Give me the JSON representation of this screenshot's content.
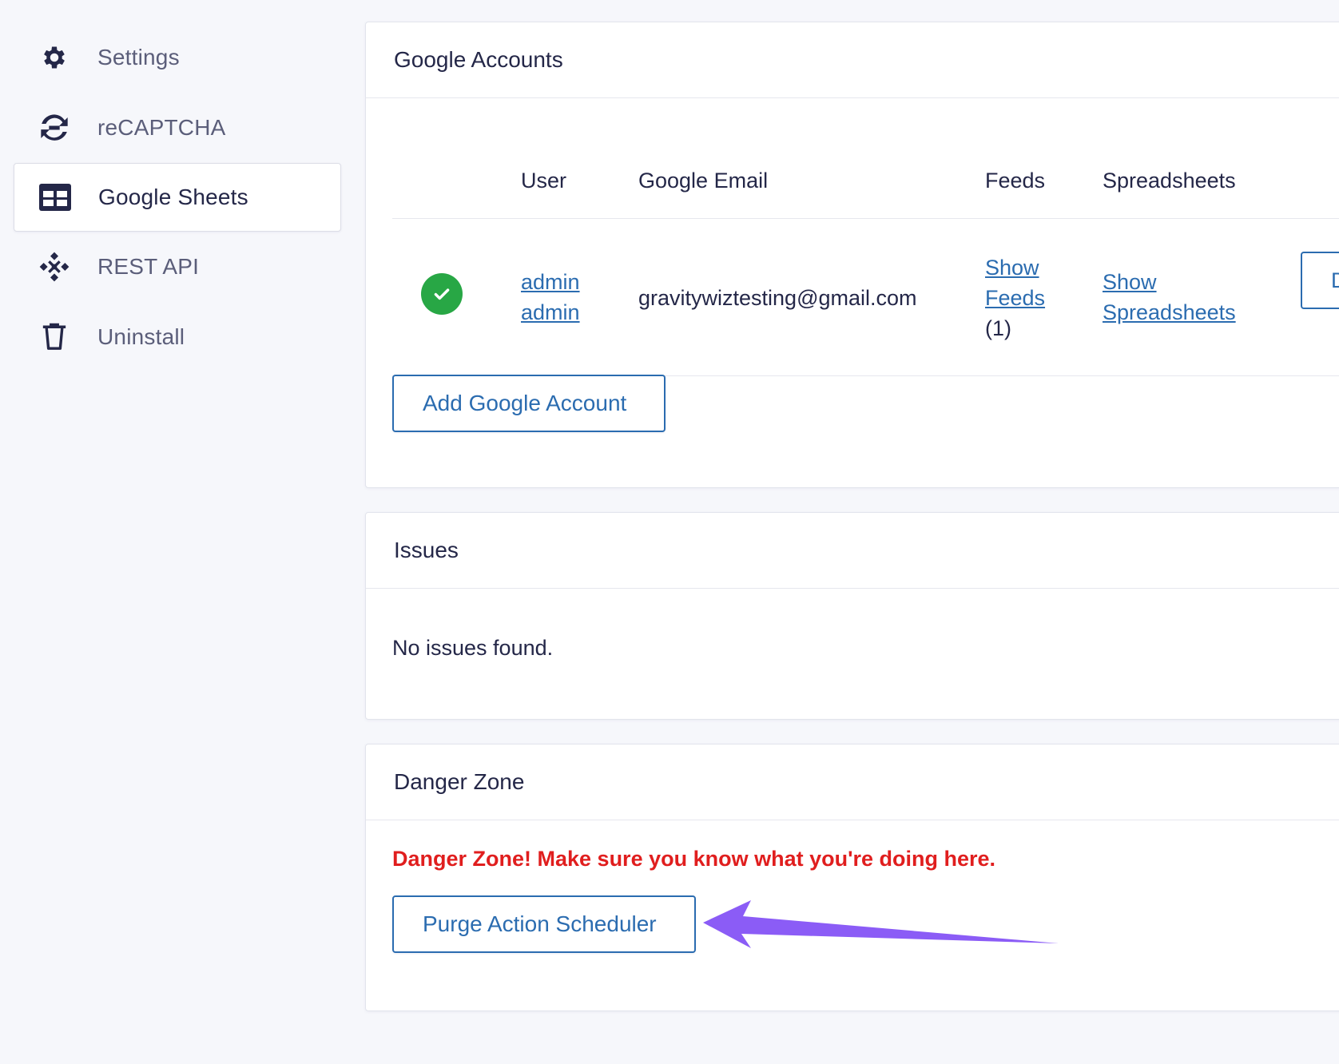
{
  "sidebar": {
    "items": [
      {
        "label": "Settings",
        "icon": "gear-icon",
        "active": false
      },
      {
        "label": "reCAPTCHA",
        "icon": "recaptcha-icon",
        "active": false
      },
      {
        "label": "Google Sheets",
        "icon": "table-icon",
        "active": true
      },
      {
        "label": "REST API",
        "icon": "api-icon",
        "active": false
      },
      {
        "label": "Uninstall",
        "icon": "trash-icon",
        "active": false
      }
    ]
  },
  "accounts": {
    "title": "Google Accounts",
    "columns": {
      "user": "User",
      "email": "Google Email",
      "feeds": "Feeds",
      "spreadsheets": "Spreadsheets"
    },
    "rows": [
      {
        "status": "connected",
        "user_line1": "admin",
        "user_line2": "admin",
        "email": "gravitywiztesting@gmail.com",
        "feeds_line1": "Show",
        "feeds_line2": "Feeds",
        "feeds_count": "(1)",
        "sheets_line1": "Show",
        "sheets_line2": "Spreadsheets",
        "action_label_visible": "D"
      }
    ],
    "add_button": "Add Google Account"
  },
  "issues": {
    "title": "Issues",
    "message": "No issues found."
  },
  "danger": {
    "title": "Danger Zone",
    "warning": "Danger Zone! Make sure you know what you're doing here.",
    "purge_button": "Purge Action Scheduler"
  },
  "colors": {
    "accent": "#2b6cb0",
    "success": "#28a745",
    "danger": "#e01e1e",
    "annotation_arrow": "#8b5cf6"
  }
}
